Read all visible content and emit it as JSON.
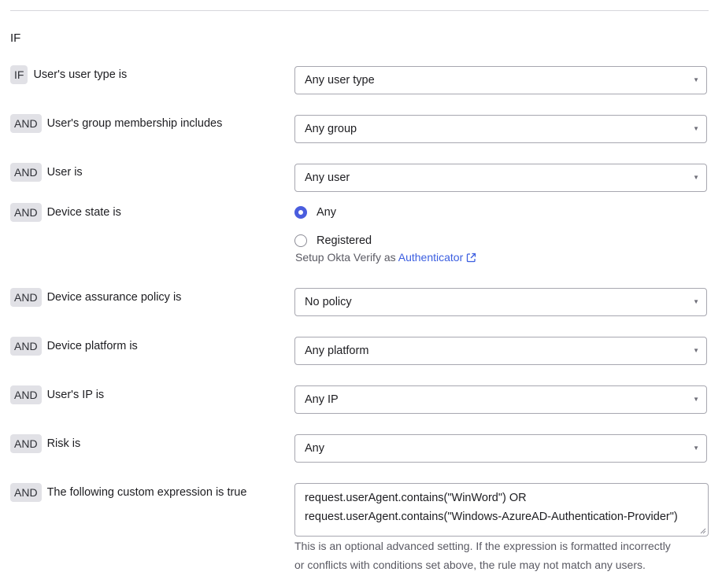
{
  "section": {
    "title": "IF"
  },
  "conditions": [
    {
      "operator": "IF",
      "label": "User's user type is",
      "value": "Any user type"
    },
    {
      "operator": "AND",
      "label": "User's group membership includes",
      "value": "Any group"
    },
    {
      "operator": "AND",
      "label": "User is",
      "value": "Any user"
    },
    {
      "operator": "AND",
      "label": "Device state is"
    },
    {
      "operator": "AND",
      "label": "Device assurance policy is",
      "value": "No policy"
    },
    {
      "operator": "AND",
      "label": "Device platform is",
      "value": "Any platform"
    },
    {
      "operator": "AND",
      "label": "User's IP is",
      "value": "Any IP"
    },
    {
      "operator": "AND",
      "label": "Risk is",
      "value": "Any"
    },
    {
      "operator": "AND",
      "label": "The following custom expression is true"
    }
  ],
  "device_state": {
    "options": [
      {
        "label": "Any",
        "selected": true
      },
      {
        "label": "Registered",
        "selected": false
      }
    ],
    "helper_prefix": "Setup Okta Verify as",
    "helper_link": "Authenticator"
  },
  "custom_expression": {
    "lines": [
      "request.userAgent.contains(\"WinWord\") OR",
      "request.userAgent.contains(\"Windows-AzureAD-Authentication-Provider\")"
    ],
    "note_lines": [
      "This is an optional advanced setting. If the expression is formatted incorrectly",
      "or conflicts with conditions set above, the rule may not match any users."
    ]
  },
  "colors": {
    "accent": "#4a5dde",
    "link": "#3b5ee0",
    "badge_bg": "#e1e1e6",
    "border": "#a7a7b0"
  },
  "icons": {
    "caret": "caret-down-icon",
    "external": "external-link-icon"
  }
}
